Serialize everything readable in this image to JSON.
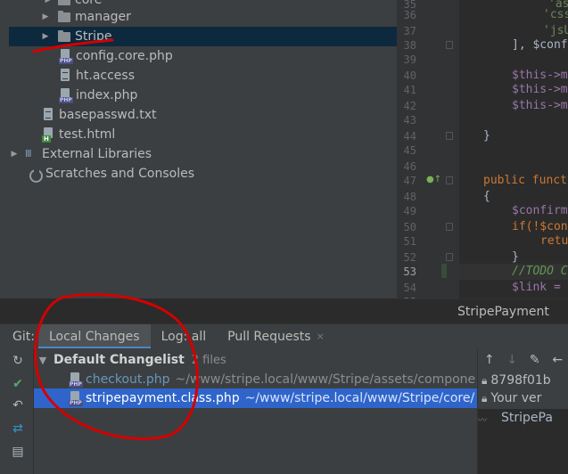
{
  "project_tree": {
    "rows": [
      {
        "label": "core",
        "type": "folder",
        "arrow": "▶",
        "indent": 1
      },
      {
        "label": "manager",
        "type": "folder",
        "arrow": "▶",
        "indent": 1
      },
      {
        "label": "Stripe",
        "type": "folder",
        "arrow": "▶",
        "indent": 1,
        "selected": true
      },
      {
        "label": "config.core.php",
        "type": "php",
        "arrow": "",
        "indent": 2
      },
      {
        "label": "ht.access",
        "type": "txt",
        "arrow": "",
        "indent": 2
      },
      {
        "label": "index.php",
        "type": "php",
        "arrow": "",
        "indent": 2
      },
      {
        "label": "basepasswd.txt",
        "type": "txt",
        "arrow": "",
        "indent": 0.5
      },
      {
        "label": "test.html",
        "type": "html",
        "arrow": "",
        "indent": 0.5
      },
      {
        "label": "External Libraries",
        "type": "lib",
        "arrow": "▶",
        "indent": -0.5
      },
      {
        "label": "Scratches and Consoles",
        "type": "scratch",
        "arrow": "",
        "indent": -0.5
      }
    ]
  },
  "editor": {
    "lines": [
      {
        "num": "35",
        "code": "'ass"
      },
      {
        "num": "36",
        "code": "'css"
      },
      {
        "num": "37",
        "code": "'jsU"
      },
      {
        "num": "38",
        "code": "], $confi"
      },
      {
        "num": "39",
        "code": ""
      },
      {
        "num": "40",
        "code": "$this->m"
      },
      {
        "num": "41",
        "code": "$this->m"
      },
      {
        "num": "42",
        "code": "$this->m"
      },
      {
        "num": "43",
        "code": ""
      },
      {
        "num": "44",
        "code": "}"
      },
      {
        "num": "45",
        "code": ""
      },
      {
        "num": "46",
        "code": ""
      },
      {
        "num": "47",
        "code": "public functi"
      },
      {
        "num": "48",
        "code": "{"
      },
      {
        "num": "49",
        "code": "$confirm"
      },
      {
        "num": "50",
        "code": "if(!$conf"
      },
      {
        "num": "51",
        "code": "retu"
      },
      {
        "num": "52",
        "code": "}"
      },
      {
        "num": "53",
        "code": "//TODO C"
      },
      {
        "num": "54",
        "code": "$link = "
      },
      {
        "num": "55",
        "code": ""
      }
    ],
    "current_line": "53",
    "breadcrumb": "StripePayment"
  },
  "git": {
    "label": "Git:",
    "tabs": [
      {
        "label": "Local Changes",
        "active": true
      },
      {
        "label": "Log: all",
        "active": false
      },
      {
        "label": "Pull Requests",
        "active": false,
        "closable": true
      }
    ],
    "close_glyph": "×",
    "changelist": {
      "title": "Default Changelist",
      "count": "2 files",
      "files": [
        {
          "name": "checkout.php",
          "path": "~/www/stripe.local/www/Stripe/assets/compone",
          "selected": false
        },
        {
          "name": "stripepayment.class.php",
          "path": "~/www/stripe.local/www/Stripe/core/",
          "selected": true
        }
      ]
    }
  },
  "right_panel": {
    "commit": "8798f01b",
    "version": "Your ver",
    "diff_title": "StripePa"
  },
  "colors": {
    "accent": "#2f65ca",
    "annotation": "#d40000"
  }
}
